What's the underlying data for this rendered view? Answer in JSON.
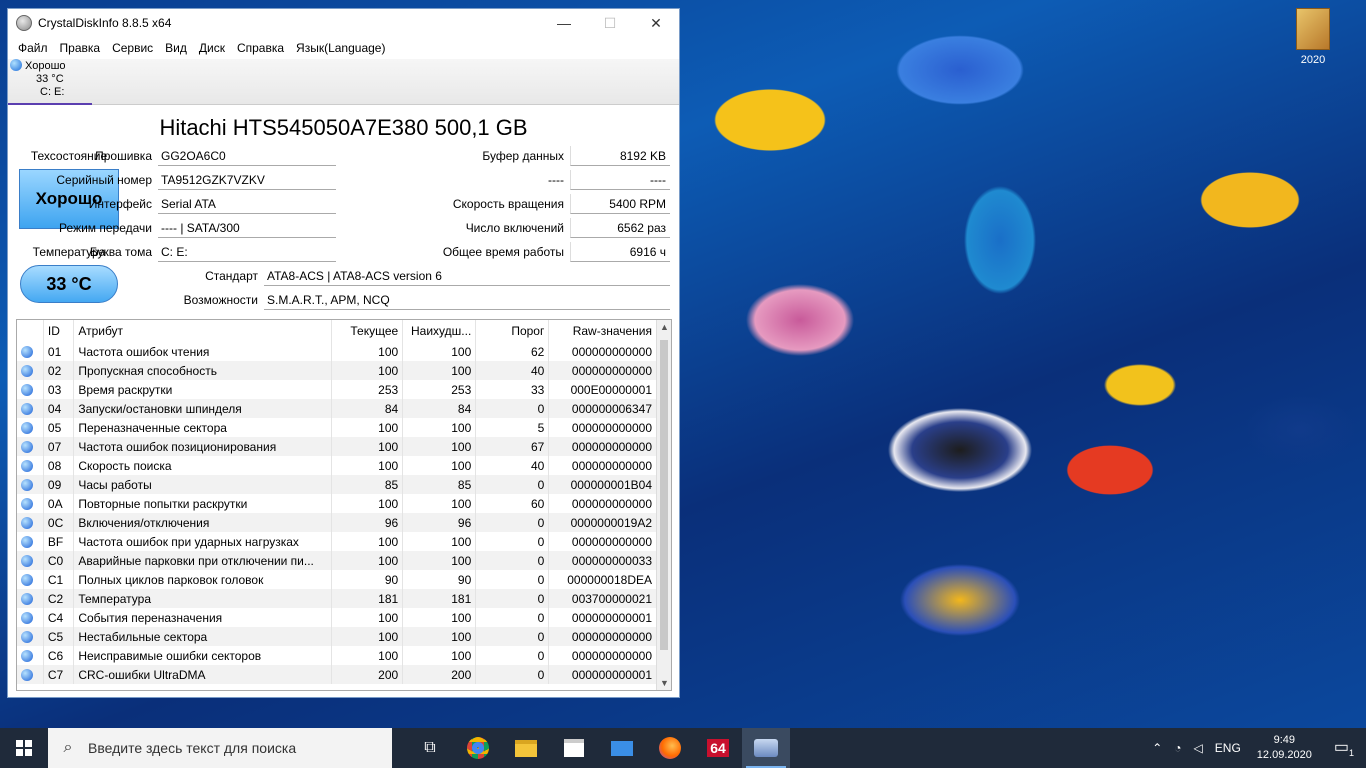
{
  "desktop": {
    "icon_label": "2020"
  },
  "window": {
    "title": "CrystalDiskInfo 8.8.5 x64",
    "minimize": "—",
    "maximize": "☐",
    "close": "✕",
    "menu": [
      "Файл",
      "Правка",
      "Сервис",
      "Вид",
      "Диск",
      "Справка",
      "Язык(Language)"
    ],
    "drive_tab": {
      "status": "Хорошо",
      "temp": "33 °C",
      "letters": "C: E:"
    },
    "model": "Hitachi HTS545050A7E380 500,1 GB",
    "health_label": "Техсостояние",
    "health_value": "Хорошо",
    "temp_label": "Температура",
    "temp_value": "33 °C",
    "info_left": [
      {
        "key": "Прошивка",
        "value": "GG2OA6C0"
      },
      {
        "key": "Серийный номер",
        "value": "TA9512GZK7VZKV"
      },
      {
        "key": "Интерфейс",
        "value": "Serial ATA"
      },
      {
        "key": "Режим передачи",
        "value": "---- | SATA/300"
      },
      {
        "key": "Буква тома",
        "value": "C: E:"
      },
      {
        "key": "Стандарт",
        "value": "ATA8-ACS | ATA8-ACS version 6"
      },
      {
        "key": "Возможности",
        "value": "S.M.A.R.T., APM, NCQ"
      }
    ],
    "info_right": [
      {
        "key": "Буфер данных",
        "value": "8192 KB"
      },
      {
        "key": "----",
        "value": "----"
      },
      {
        "key": "Скорость вращения",
        "value": "5400 RPM"
      },
      {
        "key": "Число включений",
        "value": "6562 раз"
      },
      {
        "key": "Общее время работы",
        "value": "6916 ч"
      }
    ],
    "table_headers": [
      "",
      "ID",
      "Атрибут",
      "Текущее",
      "Наихудш...",
      "Порог",
      "Raw-значения"
    ],
    "table_rows": [
      [
        "01",
        "Частота ошибок чтения",
        "100",
        "100",
        "62",
        "000000000000"
      ],
      [
        "02",
        "Пропускная способность",
        "100",
        "100",
        "40",
        "000000000000"
      ],
      [
        "03",
        "Время раскрутки",
        "253",
        "253",
        "33",
        "000E00000001"
      ],
      [
        "04",
        "Запуски/остановки шпинделя",
        "84",
        "84",
        "0",
        "000000006347"
      ],
      [
        "05",
        "Переназначенные сектора",
        "100",
        "100",
        "5",
        "000000000000"
      ],
      [
        "07",
        "Частота ошибок позиционирования",
        "100",
        "100",
        "67",
        "000000000000"
      ],
      [
        "08",
        "Скорость поиска",
        "100",
        "100",
        "40",
        "000000000000"
      ],
      [
        "09",
        "Часы работы",
        "85",
        "85",
        "0",
        "000000001B04"
      ],
      [
        "0A",
        "Повторные попытки раскрутки",
        "100",
        "100",
        "60",
        "000000000000"
      ],
      [
        "0C",
        "Включения/отключения",
        "96",
        "96",
        "0",
        "0000000019A2"
      ],
      [
        "BF",
        "Частота ошибок при ударных нагрузках",
        "100",
        "100",
        "0",
        "000000000000"
      ],
      [
        "C0",
        "Аварийные парковки при отключении пи...",
        "100",
        "100",
        "0",
        "000000000033"
      ],
      [
        "C1",
        "Полных циклов парковок головок",
        "90",
        "90",
        "0",
        "000000018DEA"
      ],
      [
        "C2",
        "Температура",
        "181",
        "181",
        "0",
        "003700000021"
      ],
      [
        "C4",
        "События переназначения",
        "100",
        "100",
        "0",
        "000000000001"
      ],
      [
        "C5",
        "Нестабильные сектора",
        "100",
        "100",
        "0",
        "000000000000"
      ],
      [
        "C6",
        "Неисправимые ошибки секторов",
        "100",
        "100",
        "0",
        "000000000000"
      ],
      [
        "C7",
        "CRC-ошибки UltraDMA",
        "200",
        "200",
        "0",
        "000000000001"
      ]
    ]
  },
  "taskbar": {
    "search_placeholder": "Введите здесь текст для поиска",
    "apps": [
      "task-view-icon",
      "chrome-icon",
      "file-explorer-icon",
      "store-icon",
      "mail-icon",
      "firefox-icon",
      "64-app-icon",
      "crystaldiskinfo-icon"
    ],
    "app_64_label": "64",
    "lang": "ENG",
    "time": "9:49",
    "date": "12.09.2020",
    "notification_count": "1"
  }
}
